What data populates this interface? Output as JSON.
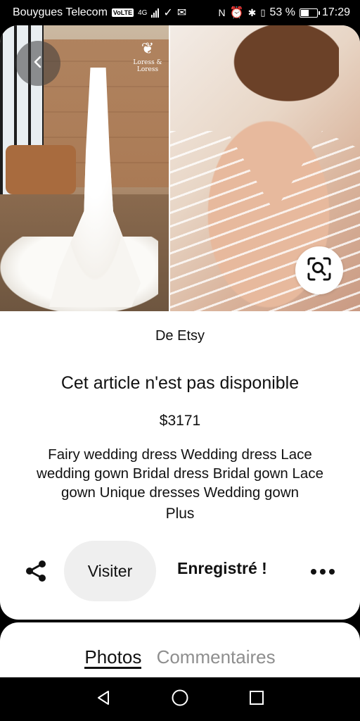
{
  "status_bar": {
    "carrier": "Bouygues Telecom",
    "volte": "VoLTE",
    "network": "4G",
    "battery_percent": "53 %",
    "battery_level": 0.53,
    "time": "17:29"
  },
  "hero": {
    "logo_text": "Loress & Loress",
    "back_icon": "chevron-left-icon",
    "lens_icon": "visual-search-icon"
  },
  "pin": {
    "source_prefix": "De",
    "source_name": "Etsy",
    "title": "Cet article n'est pas disponible",
    "price": "$3171",
    "description": "Fairy wedding dress Wedding dress Lace wedding gown Bridal dress Bridal gown Lace gown Unique dresses Wedding gown",
    "more_label": "Plus"
  },
  "actions": {
    "share_icon": "share-icon",
    "visit_label": "Visiter",
    "saved_label": "Enregistré !",
    "more_icon": "more-dots-icon"
  },
  "tabs": [
    {
      "label": "Photos",
      "active": true
    },
    {
      "label": "Commentaires",
      "active": false
    }
  ],
  "navbar": {
    "back_icon": "nav-back-icon",
    "home_icon": "nav-home-icon",
    "recents_icon": "nav-recents-icon"
  }
}
